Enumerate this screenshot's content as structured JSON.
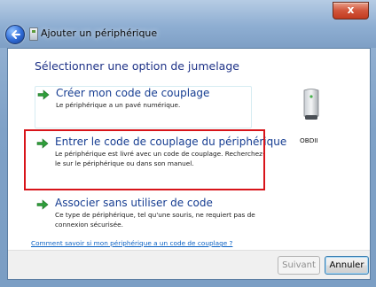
{
  "window": {
    "title": "Ajouter un périphérique",
    "close_label": "x"
  },
  "page": {
    "heading": "Sélectionner une option de jumelage"
  },
  "options": [
    {
      "title": "Créer mon code de couplage",
      "description": "Le périphérique a un pavé numérique."
    },
    {
      "title": "Entrer le code de couplage du périphérique",
      "description": "Le périphérique est livré avec un code de couplage. Recherchez-le sur le périphérique ou dans son manuel."
    },
    {
      "title": "Associer sans utiliser de code",
      "description": "Ce type de périphérique, tel qu'une souris, ne requiert pas de connexion sécurisée."
    }
  ],
  "help_link": "Comment savoir si mon périphérique a un code de couplage ?",
  "device": {
    "name": "OBDII",
    "icon": "tower-device-icon"
  },
  "footer": {
    "next_label": "Suivant",
    "cancel_label": "Annuler"
  },
  "colors": {
    "accent_red": "#d8141a",
    "title_blue": "#153c91",
    "arrow_green": "#2e9e3a"
  }
}
